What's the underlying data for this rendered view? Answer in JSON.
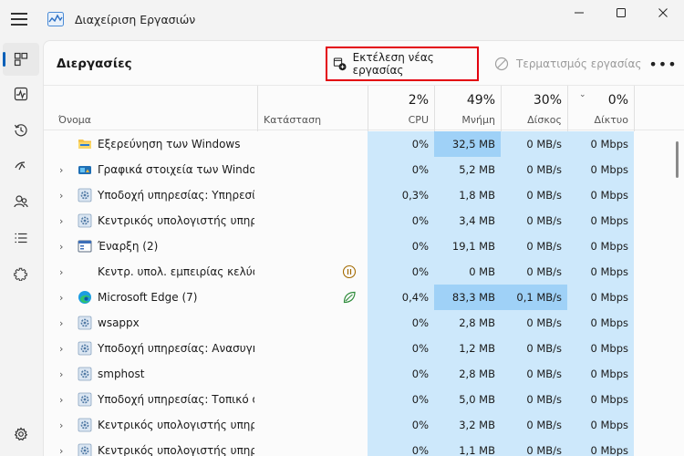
{
  "window": {
    "title": "Διαχείριση Εργασιών",
    "controls": [
      "minimize",
      "maximize",
      "close"
    ]
  },
  "nav": {
    "items": [
      {
        "name": "processes",
        "icon": "processes-icon",
        "active": true
      },
      {
        "name": "performance",
        "icon": "performance-icon"
      },
      {
        "name": "app-history",
        "icon": "history-icon"
      },
      {
        "name": "startup",
        "icon": "startup-icon"
      },
      {
        "name": "users",
        "icon": "users-icon"
      },
      {
        "name": "details",
        "icon": "details-icon"
      },
      {
        "name": "services",
        "icon": "services-icon"
      }
    ],
    "settings_icon": "gear-icon"
  },
  "toolbar": {
    "page_title": "Διεργασίες",
    "run_task_label": "Εκτέλεση νέας εργασίας",
    "end_task_label": "Τερματισμός εργασίας",
    "more_label": "•••"
  },
  "columns": {
    "name": "Όνομα",
    "status": "Κατάσταση",
    "cpu": {
      "pct": "2%",
      "label": "CPU"
    },
    "memory": {
      "pct": "49%",
      "label": "Μνήμη"
    },
    "disk": {
      "pct": "30%",
      "label": "Δίσκος"
    },
    "network": {
      "pct": "0%",
      "label": "Δίκτυο"
    }
  },
  "rows": [
    {
      "name": "Εξερεύνηση των Windows",
      "expand": false,
      "icon": "explorer",
      "status": "",
      "cpu": "0%",
      "mem": "32,5 MB",
      "disk": "0 MB/s",
      "net": "0 Mbps",
      "mem_hl": "mid"
    },
    {
      "name": "Γραφικά στοιχεία των Windows",
      "expand": true,
      "icon": "widgets",
      "status": "",
      "cpu": "0%",
      "mem": "5,2 MB",
      "disk": "0 MB/s",
      "net": "0 Mbps"
    },
    {
      "name": "Υποδοχή υπηρεσίας: Υπηρεσίες",
      "expand": true,
      "icon": "gear",
      "status": "",
      "cpu": "0,3%",
      "mem": "1,8 MB",
      "disk": "0 MB/s",
      "net": "0 Mbps"
    },
    {
      "name": "Κεντρικός υπολογιστής υπηρεσιών",
      "expand": true,
      "icon": "gear",
      "status": "",
      "cpu": "0%",
      "mem": "3,4 MB",
      "disk": "0 MB/s",
      "net": "0 Mbps"
    },
    {
      "name": "Έναρξη (2)",
      "expand": true,
      "icon": "window",
      "status": "",
      "cpu": "0%",
      "mem": "19,1 MB",
      "disk": "0 MB/s",
      "net": "0 Mbps"
    },
    {
      "name": "Κεντρ. υπολ. εμπειρίας κελύφους",
      "expand": true,
      "icon": "none",
      "status": "paused",
      "cpu": "0%",
      "mem": "0 MB",
      "disk": "0 MB/s",
      "net": "0 Mbps"
    },
    {
      "name": "Microsoft Edge (7)",
      "expand": true,
      "icon": "edge",
      "status": "efficiency",
      "cpu": "0,4%",
      "mem": "83,3 MB",
      "disk": "0,1 MB/s",
      "net": "0 Mbps",
      "mem_hl": "mid",
      "disk_hl": "mid"
    },
    {
      "name": "wsappx",
      "expand": true,
      "icon": "gear",
      "status": "",
      "cpu": "0%",
      "mem": "2,8 MB",
      "disk": "0 MB/s",
      "net": "0 Mbps"
    },
    {
      "name": "Υποδοχή υπηρεσίας: Ανασυγκρότηση",
      "expand": true,
      "icon": "gear",
      "status": "",
      "cpu": "0%",
      "mem": "1,2 MB",
      "disk": "0 MB/s",
      "net": "0 Mbps"
    },
    {
      "name": "smphost",
      "expand": true,
      "icon": "gear",
      "status": "",
      "cpu": "0%",
      "mem": "2,8 MB",
      "disk": "0 MB/s",
      "net": "0 Mbps"
    },
    {
      "name": "Υποδοχή υπηρεσίας: Τοπικό σύστημα",
      "expand": true,
      "icon": "gear",
      "status": "",
      "cpu": "0%",
      "mem": "5,0 MB",
      "disk": "0 MB/s",
      "net": "0 Mbps"
    },
    {
      "name": "Κεντρικός υπολογιστής υπηρεσιών",
      "expand": true,
      "icon": "gear",
      "status": "",
      "cpu": "0%",
      "mem": "3,2 MB",
      "disk": "0 MB/s",
      "net": "0 Mbps"
    },
    {
      "name": "Κεντρικός υπολογιστής υπηρεσιών",
      "expand": true,
      "icon": "gear",
      "status": "",
      "cpu": "0%",
      "mem": "1,1 MB",
      "disk": "0 MB/s",
      "net": "0 Mbps"
    }
  ],
  "colors": {
    "accent": "#005fb8",
    "highlight_light": "#cde8fb",
    "highlight_mid": "#9fd1f7",
    "callout": "#e3000f"
  }
}
